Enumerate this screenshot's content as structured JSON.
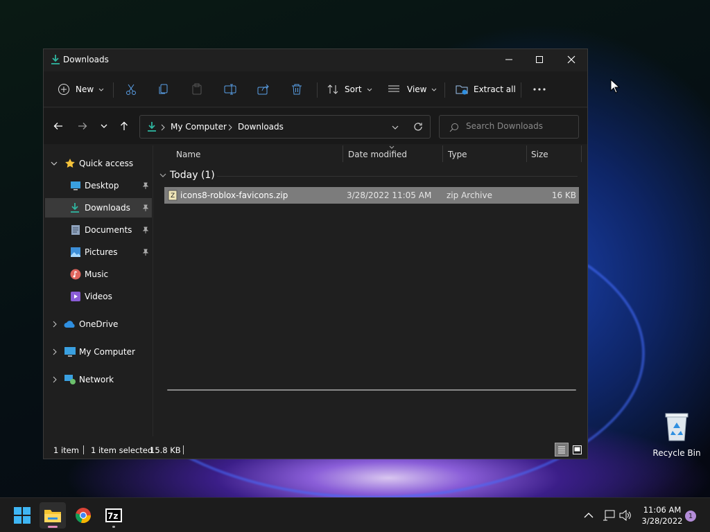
{
  "window": {
    "title": "Downloads"
  },
  "toolbar": {
    "new_label": "New",
    "sort_label": "Sort",
    "view_label": "View",
    "extract_label": "Extract all"
  },
  "address": {
    "crumbs": [
      "My Computer",
      "Downloads"
    ]
  },
  "search": {
    "placeholder": "Search Downloads"
  },
  "sidebar": {
    "quick_access": "Quick access",
    "items": [
      {
        "label": "Desktop",
        "pinned": true
      },
      {
        "label": "Downloads",
        "pinned": true,
        "selected": true
      },
      {
        "label": "Documents",
        "pinned": true
      },
      {
        "label": "Pictures",
        "pinned": true
      },
      {
        "label": "Music",
        "pinned": false
      },
      {
        "label": "Videos",
        "pinned": false
      }
    ],
    "onedrive": "OneDrive",
    "my_computer": "My Computer",
    "network": "Network"
  },
  "columns": [
    "Name",
    "Date modified",
    "Type",
    "Size"
  ],
  "group": {
    "label": "Today (1)"
  },
  "files": [
    {
      "name": "icons8-roblox-favicons.zip",
      "date": "3/28/2022 11:05 AM",
      "type": "zip Archive",
      "size": "16 KB"
    }
  ],
  "status": {
    "count": "1 item",
    "selected": "1 item selected",
    "size": "15.8 KB"
  },
  "desktop": {
    "recycle_bin": "Recycle Bin"
  },
  "taskbar": {
    "time": "11:06 AM",
    "date": "3/28/2022",
    "notifications": "1"
  },
  "colors": {
    "accent": "#2fb6a0",
    "selection": "#7c7c7c",
    "badge": "#b38cd8"
  }
}
